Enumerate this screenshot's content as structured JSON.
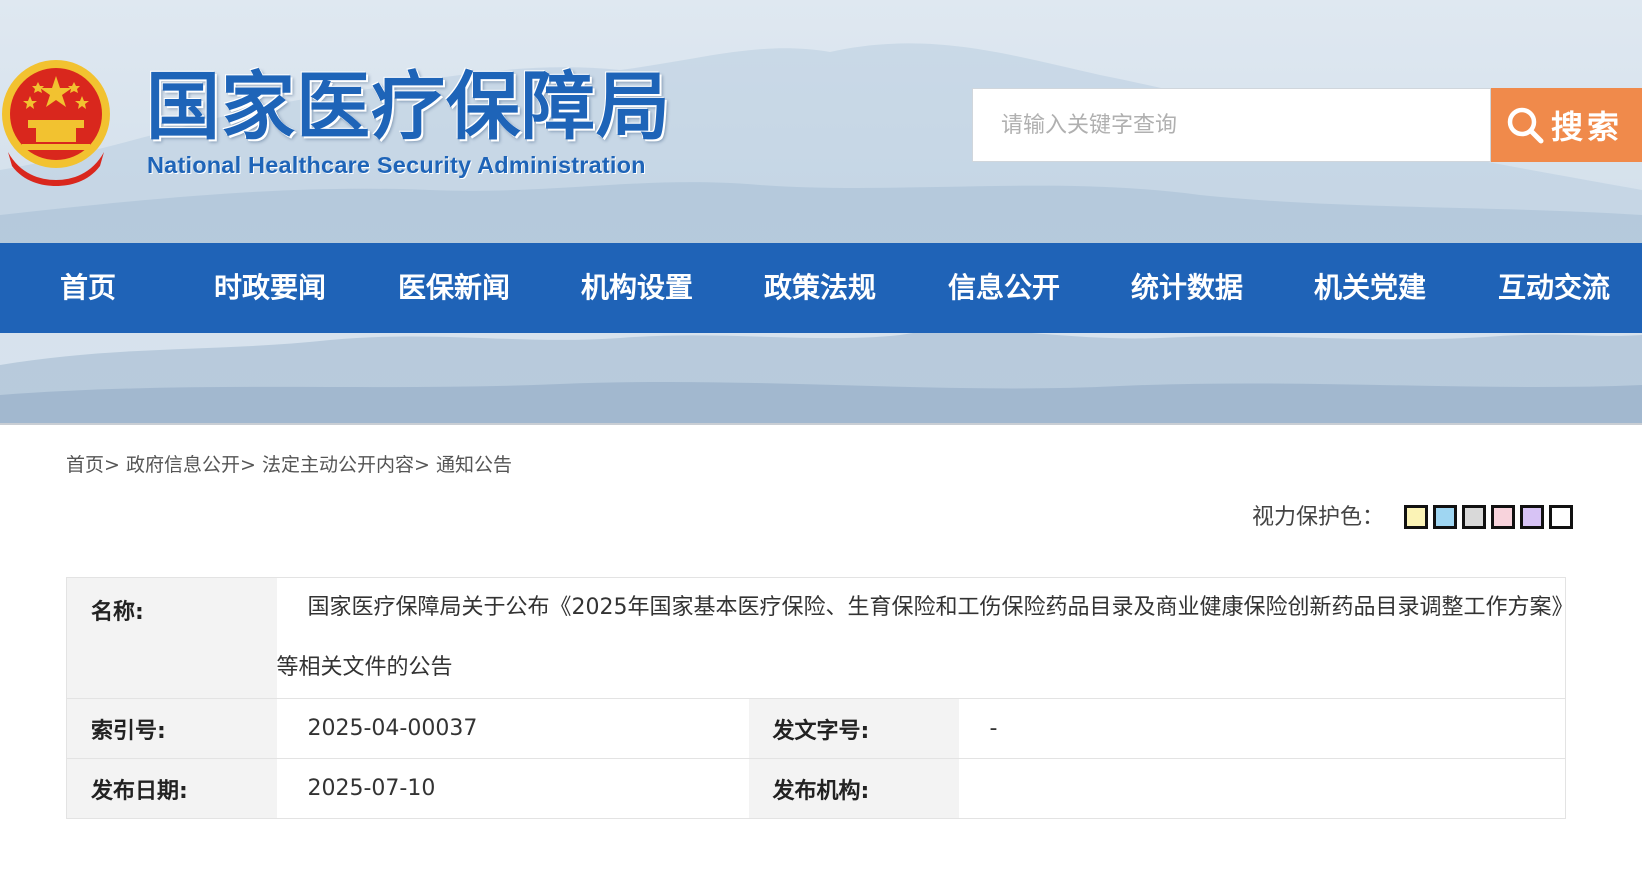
{
  "header": {
    "logo_cn": "国家医疗保障局",
    "logo_en": "National Healthcare Security Administration",
    "search": {
      "placeholder": "请输入关键字查询",
      "button_label": "搜索"
    }
  },
  "nav": {
    "items": [
      {
        "label": "首页"
      },
      {
        "label": "时政要闻"
      },
      {
        "label": "医保新闻"
      },
      {
        "label": "机构设置"
      },
      {
        "label": "政策法规"
      },
      {
        "label": "信息公开"
      },
      {
        "label": "统计数据"
      },
      {
        "label": "机关党建"
      },
      {
        "label": "互动交流"
      }
    ]
  },
  "breadcrumb": {
    "items": [
      {
        "label": "首页"
      },
      {
        "label": "政府信息公开"
      },
      {
        "label": "法定主动公开内容"
      },
      {
        "label": "通知公告"
      }
    ],
    "separator": ">"
  },
  "eye_protection": {
    "label": "视力保护色：",
    "colors": [
      "#fbf3b6",
      "#9fd6f2",
      "#d9d9d9",
      "#f8d3dc",
      "#d7c3f5",
      "#ffffff"
    ]
  },
  "info": {
    "title_label": "名称:",
    "title_value": "国家医疗保障局关于公布《2025年国家基本医疗保险、生育保险和工伤保险药品目录及商业健康保险创新药品目录调整工作方案》等相关文件的公告",
    "index_label": "索引号:",
    "index_value": "2025-04-00037",
    "doc_no_label": "发文字号:",
    "doc_no_value": "-",
    "date_label": "发布日期:",
    "date_value": "2025-07-10",
    "issuer_label": "发布机构:",
    "issuer_value": ""
  },
  "colors": {
    "nav_blue": "#1f63b7",
    "logo_blue": "#1e64b8",
    "search_orange": "#f08a4b",
    "emblem_red": "#d9271d",
    "emblem_gold": "#f2c230"
  }
}
